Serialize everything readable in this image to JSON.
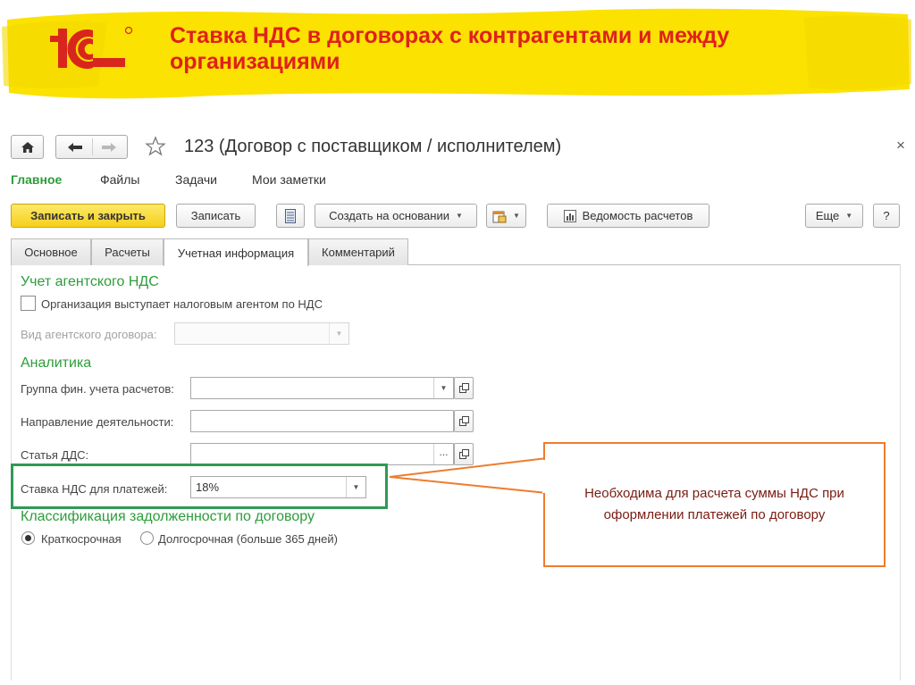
{
  "header": {
    "title": "Ставка НДС в договорах с контрагентами и между организациями",
    "logo_text": "1С",
    "colors": {
      "stroke": "#fbe200",
      "title": "#e0201b",
      "logo": "#d9261c"
    }
  },
  "window": {
    "title": "123 (Договор с поставщиком / исполнителем)",
    "close_glyph": "×"
  },
  "menu": [
    {
      "label": "Главное",
      "active": true
    },
    {
      "label": "Файлы"
    },
    {
      "label": "Задачи"
    },
    {
      "label": "Мои заметки"
    }
  ],
  "toolbar": {
    "save_close": "Записать и закрыть",
    "save": "Записать",
    "create_based": "Создать на основании",
    "report": "Ведомость расчетов",
    "more": "Еще",
    "help": "?"
  },
  "tabs": [
    {
      "label": "Основное"
    },
    {
      "label": "Расчеты"
    },
    {
      "label": "Учетная информация",
      "active": true
    },
    {
      "label": "Комментарий"
    }
  ],
  "form": {
    "agent_section": "Учет агентского НДС",
    "agent_checkbox": "Организация выступает налоговым агентом по НДС",
    "agent_checkbox_checked": false,
    "agent_contract_type_label": "Вид агентского договора:",
    "agent_contract_type_value": "",
    "analytics_section": "Аналитика",
    "fin_group_label": "Группа фин. учета расчетов:",
    "fin_group_value": "",
    "direction_label": "Направление деятельности:",
    "direction_value": "",
    "dds_label": "Статья ДДС:",
    "dds_value": "",
    "vat_rate_label": "Ставка НДС для платежей:",
    "vat_rate_value": "18%",
    "debt_section": "Классификация задолженности по договору",
    "debt_options": [
      {
        "label": "Краткосрочная",
        "selected": true
      },
      {
        "label": "Долгосрочная (больше 365 дней)",
        "selected": false
      }
    ]
  },
  "callout": {
    "text": "Необходима для расчета суммы НДС при оформлении платежей по договору",
    "colors": {
      "border": "#ef7c2e",
      "text": "#7a1c12",
      "highlight": "#2f9a55"
    }
  }
}
